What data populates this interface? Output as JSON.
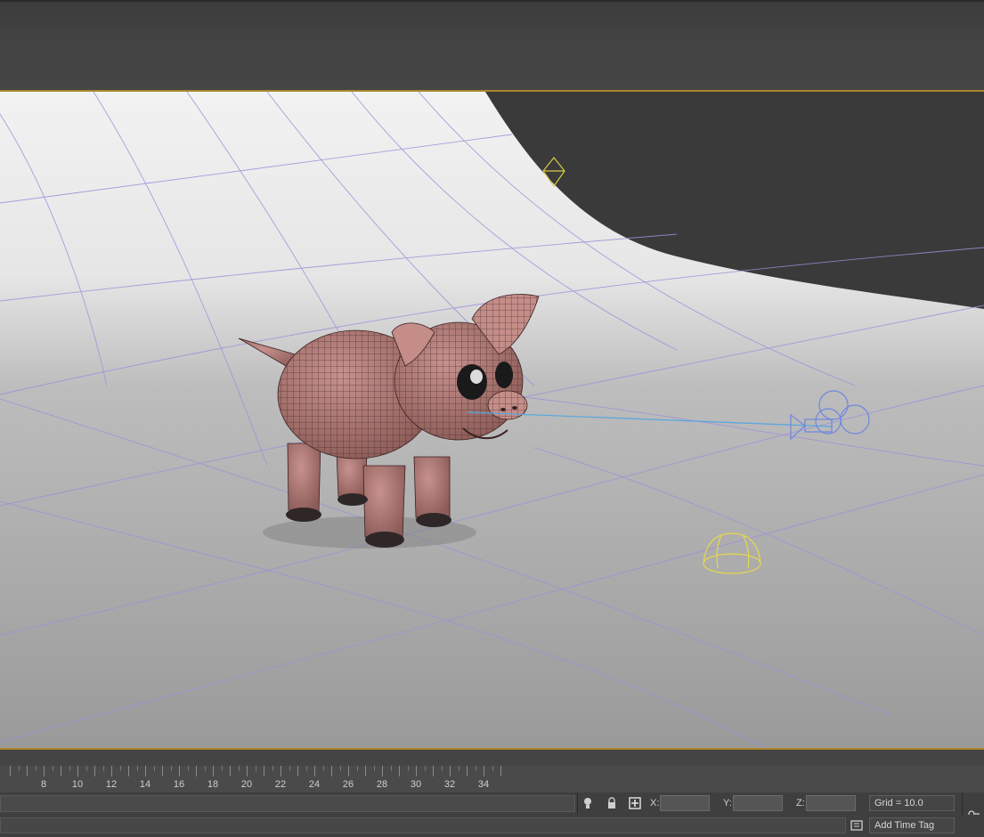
{
  "timeline": {
    "ticks": [
      "8",
      "10",
      "12",
      "14",
      "16",
      "18",
      "20",
      "22",
      "24",
      "26",
      "28",
      "30",
      "32",
      "34"
    ]
  },
  "status": {
    "x_label": "X:",
    "y_label": "Y:",
    "z_label": "Z:",
    "x_value": "",
    "y_value": "",
    "z_value": "",
    "grid": "Grid = 10.0",
    "time_tag": "Add Time Tag"
  },
  "icons": {
    "selection_lock": "lock-icon",
    "isolate": "bulb-icon",
    "absolute_mode": "transform-mode-icon",
    "key_filter": "key-icon",
    "time_config": "time-config-icon"
  },
  "colors": {
    "selection_border": "#a8862a",
    "pig_wire": "#3a2222",
    "pig_skin": "#b07a76",
    "camera": "#6f86e0",
    "light": "#e6d94a",
    "grid_line": "#9e8fd8"
  }
}
